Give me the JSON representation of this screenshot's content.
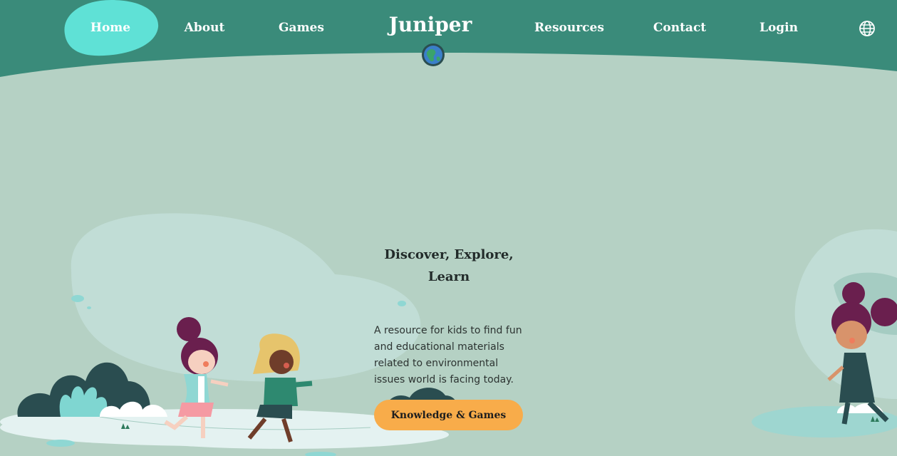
{
  "nav": {
    "items": [
      {
        "label": "Home",
        "active": true
      },
      {
        "label": "About"
      },
      {
        "label": "Games"
      },
      {
        "label": "Resources"
      },
      {
        "label": "Contact"
      },
      {
        "label": "Login"
      }
    ],
    "brand": "Juniper",
    "logo_icon": "earth-globe-icon",
    "language_icon": "globe-language-icon"
  },
  "hero": {
    "title_line1": "Discover, Explore,",
    "title_line2": "Learn",
    "description": "A resource for kids to find fun and educational materials related to environmental issues world is facing today.",
    "cta_label": "Knowledge & Games"
  },
  "colors": {
    "header": "#3a8b7a",
    "background": "#b5d1c4",
    "active_blob": "#5fe1d6",
    "cta": "#f8ac4a",
    "hair": "#6a1f4e",
    "dark_bush": "#2a4d50"
  }
}
